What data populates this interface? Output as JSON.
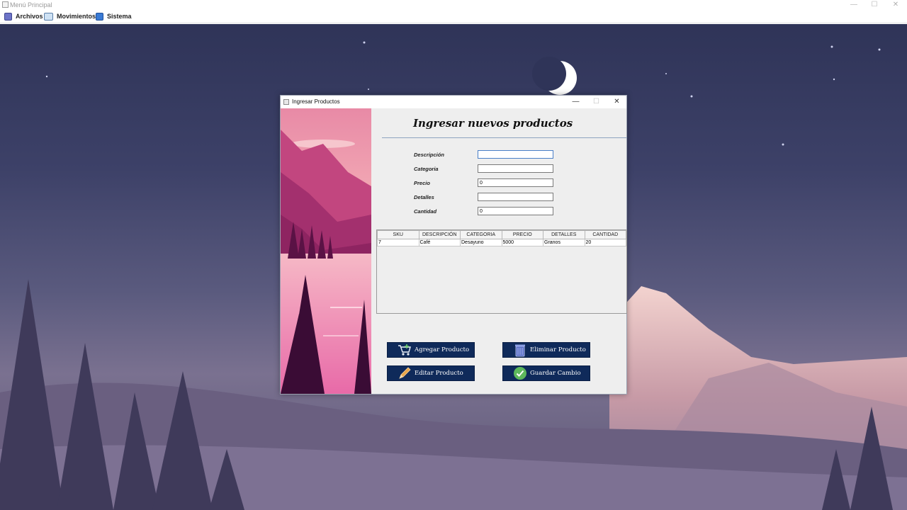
{
  "main_window": {
    "title": "Menú Principal",
    "controls": {
      "minimize": "—",
      "maximize": "☐",
      "close": "✕"
    }
  },
  "menubar": {
    "items": [
      {
        "label": "Archivos",
        "icon": "list-icon"
      },
      {
        "label": "Movimientos",
        "icon": "book-icon"
      },
      {
        "label": "Sistema",
        "icon": "cloud-icon"
      }
    ]
  },
  "dialog": {
    "title": "Ingresar Productos",
    "controls": {
      "minimize": "—",
      "maximize": "☐",
      "close": "✕"
    },
    "heading": "Ingresar nuevos productos",
    "fields": [
      {
        "label": "Descripción",
        "value": ""
      },
      {
        "label": "Categoria",
        "value": ""
      },
      {
        "label": "Precio",
        "value": "0"
      },
      {
        "label": "Detalles",
        "value": ""
      },
      {
        "label": "Cantidad",
        "value": "0"
      }
    ],
    "table": {
      "columns": [
        "SKU",
        "DESCRIPCIÓN",
        "CATEGORIA",
        "PRECIO",
        "DETALLES",
        "CANTIDAD"
      ],
      "rows": [
        [
          "7",
          "Café",
          "Desayuno",
          "5000",
          "Granos",
          "20"
        ]
      ]
    },
    "buttons": {
      "add": "Agregar Producto",
      "delete": "Eliminar Producto",
      "edit": "Editar Producto",
      "save": "Guardar Cambio"
    }
  },
  "colors": {
    "button_bg": "#0f2a5a",
    "desktop_sky": "#2f3458",
    "moon": "#ffffff",
    "art_pink": "#e06a9a"
  }
}
